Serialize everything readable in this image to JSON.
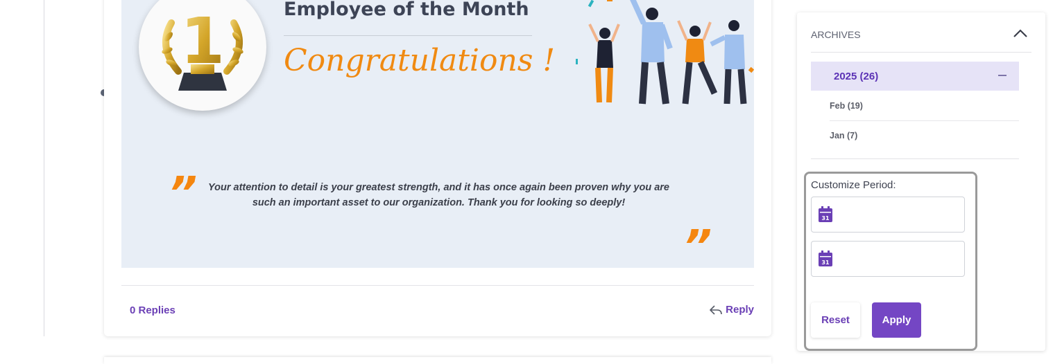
{
  "post": {
    "banner_title": "Employee of the Month",
    "banner_subtitle": "Congratulations !",
    "medal_number": "1",
    "quote": "Your attention to detail is your greatest strength, and it has once again been proven why you are such an important asset to our organization. Thank you for looking so deeply!",
    "quote_open": "”",
    "quote_close": "”",
    "replies_label": "0 Replies",
    "reply_label": "Reply"
  },
  "archives": {
    "title": "ARCHIVES",
    "year": {
      "label": "2025 (26)"
    },
    "months": [
      {
        "label": "Feb (19)"
      },
      {
        "label": "Jan (7)"
      }
    ],
    "customize": {
      "label": "Customize Period:",
      "start_value": "",
      "end_value": "",
      "calendar_day": "31",
      "reset_label": "Reset",
      "apply_label": "Apply"
    }
  },
  "colors": {
    "accent": "#7446c4",
    "orange": "#f08a12",
    "banner_bg": "#e8eef6",
    "selected_bg": "#e6e3f7"
  }
}
